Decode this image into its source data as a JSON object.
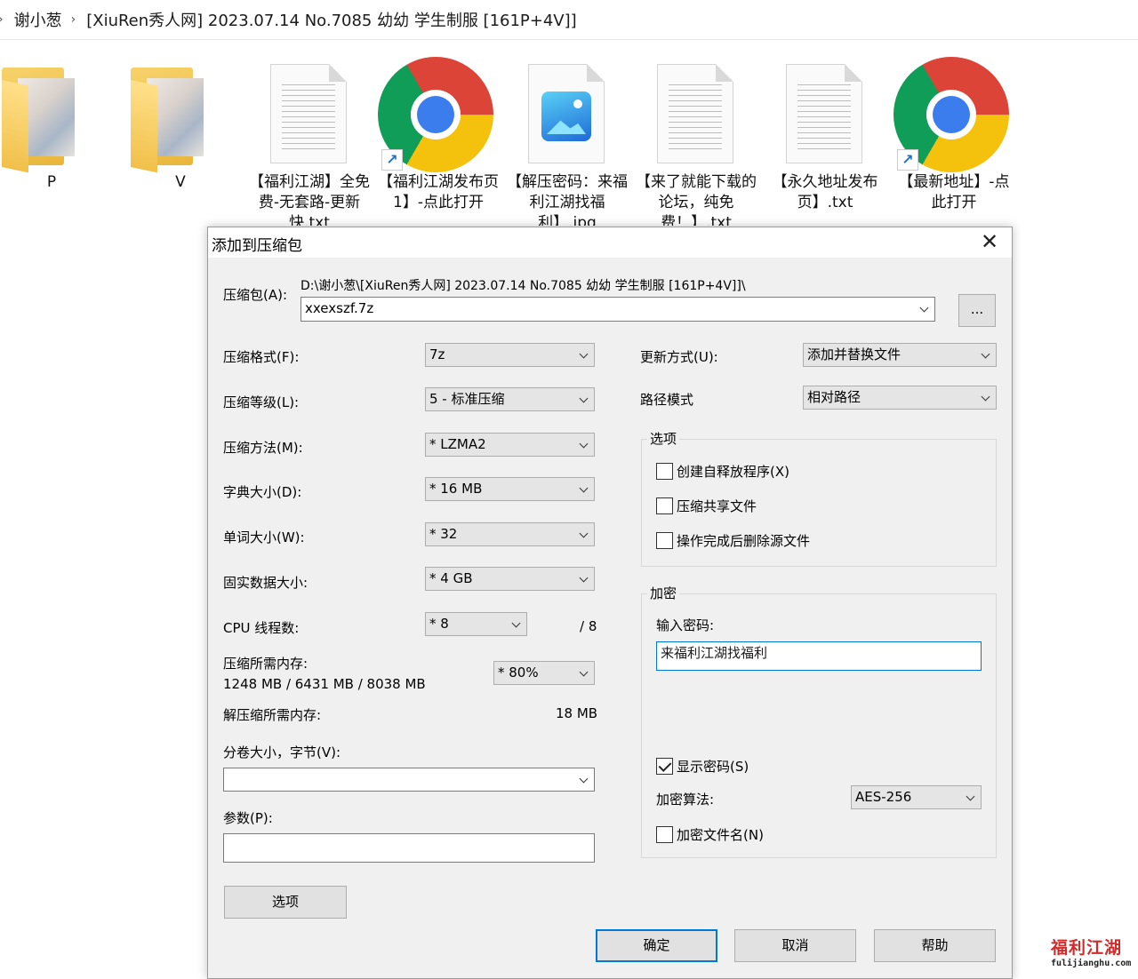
{
  "breadcrumb": {
    "items": [
      "谢小葱",
      "[XiuRen秀人网] 2023.07.14 No.7085 幼幼 学生制服 [161P+4V]]"
    ]
  },
  "files": [
    {
      "name": "P",
      "type": "folder-icon"
    },
    {
      "name": "V",
      "type": "folder-icon"
    },
    {
      "name": "【福利江湖】全免费-无套路-更新快.txt",
      "type": "text-file-icon"
    },
    {
      "name": "【福利江湖发布页1】-点此打开",
      "type": "chrome-shortcut-icon"
    },
    {
      "name": "【解压密码：来福利江湖找福利】.jpg",
      "type": "image-file-icon"
    },
    {
      "name": "【来了就能下载的论坛，纯免费！】.txt",
      "type": "text-file-icon"
    },
    {
      "name": "【永久地址发布页】.txt",
      "type": "text-file-icon"
    },
    {
      "name": "【最新地址】-点此打开",
      "type": "chrome-shortcut-icon"
    }
  ],
  "dialog": {
    "title": "添加到压缩包",
    "close_glyph": "✕",
    "archive_label": "压缩包(A):",
    "archive_path": "D:\\谢小葱\\[XiuRen秀人网] 2023.07.14 No.7085 幼幼 学生制服 [161P+4V]]\\",
    "archive_name": "xxexszf.7z",
    "browse_label": "...",
    "format_label": "压缩格式(F):",
    "format_value": "7z",
    "level_label": "压缩等级(L):",
    "level_value": "5 - 标准压缩",
    "method_label": "压缩方法(M):",
    "method_value": "*  LZMA2",
    "dict_label": "字典大小(D):",
    "dict_value": "*  16 MB",
    "word_label": "单词大小(W):",
    "word_value": "*  32",
    "solid_label": "固实数据大小:",
    "solid_value": "*  4 GB",
    "cpu_label": "CPU 线程数:",
    "cpu_value": "*  8",
    "cpu_total": "/ 8",
    "mem_label": "压缩所需内存:",
    "mem_value": "1248 MB / 6431 MB / 8038 MB",
    "mem_percent": "*  80%",
    "demem_label": "解压缩所需内存:",
    "demem_value": "18 MB",
    "split_label": "分卷大小，字节(V):",
    "split_value": "",
    "params_label": "参数(P):",
    "params_value": "",
    "options_button": "选项",
    "update_label": "更新方式(U):",
    "update_value": "添加并替换文件",
    "path_label": "路径模式",
    "path_value": "相对路径",
    "options_group": "选项",
    "opt_sfx": "创建自释放程序(X)",
    "opt_shared": "压缩共享文件",
    "opt_delete": "操作完成后删除源文件",
    "encrypt_group": "加密",
    "password_label": "输入密码:",
    "password_value": "来福利江湖找福利",
    "show_password": "显示密码(S)",
    "algo_label": "加密算法:",
    "algo_value": "AES-256",
    "encrypt_names": "加密文件名(N)",
    "ok": "确定",
    "cancel": "取消",
    "help": "帮助"
  },
  "watermark": {
    "title": "福利江湖",
    "url": "fulijianghu.com"
  }
}
